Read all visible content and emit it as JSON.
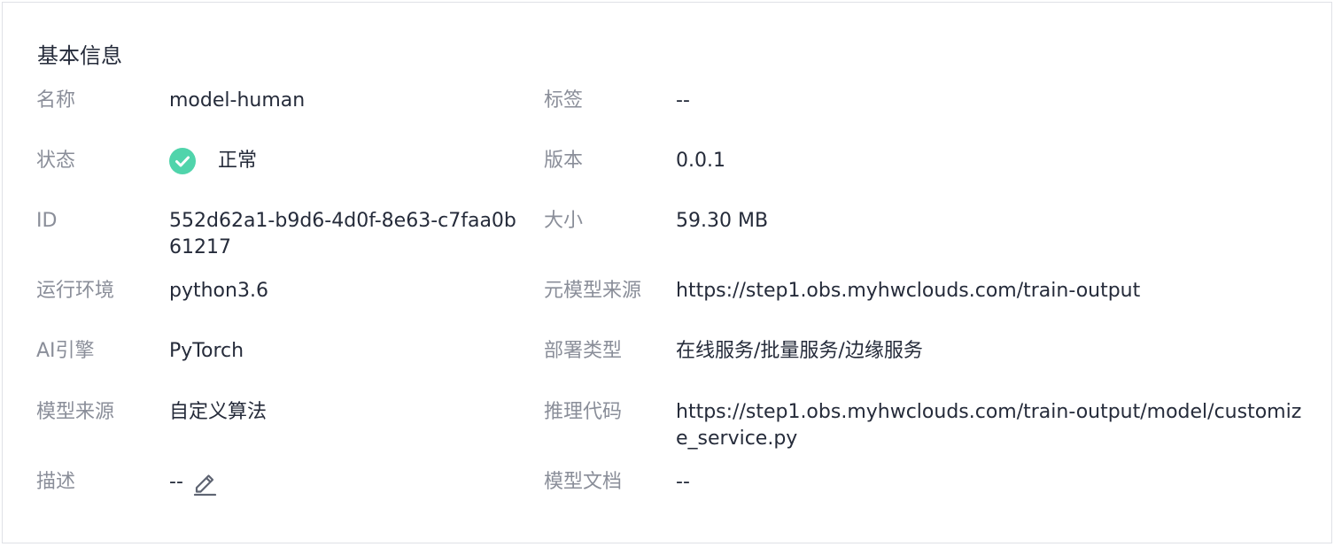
{
  "section": {
    "title": "基本信息"
  },
  "fields": {
    "name": {
      "label": "名称",
      "value": "model-human"
    },
    "tags": {
      "label": "标签",
      "value": "--"
    },
    "status": {
      "label": "状态",
      "value": "正常",
      "icon": "check-circle-icon",
      "color": "#50d4ab"
    },
    "version": {
      "label": "版本",
      "value": "0.0.1"
    },
    "id": {
      "label": "ID",
      "value": "552d62a1-b9d6-4d0f-8e63-c7faa0b61217"
    },
    "size": {
      "label": "大小",
      "value": "59.30 MB"
    },
    "runtime": {
      "label": "运行环境",
      "value": "python3.6"
    },
    "meta_source": {
      "label": "元模型来源",
      "value": "https://step1.obs.myhwclouds.com/train-output"
    },
    "ai_engine": {
      "label": "AI引擎",
      "value": "PyTorch"
    },
    "deploy_type": {
      "label": "部署类型",
      "value": "在线服务/批量服务/边缘服务"
    },
    "model_source": {
      "label": "模型来源",
      "value": "自定义算法"
    },
    "inference_code": {
      "label": "推理代码",
      "value": "https://step1.obs.myhwclouds.com/train-output/model/customize_service.py"
    },
    "description": {
      "label": "描述",
      "value": "--",
      "icon": "edit-icon"
    },
    "model_doc": {
      "label": "模型文档",
      "value": "--"
    }
  },
  "colors": {
    "label": "#8a8e99",
    "value": "#252b3a",
    "border": "#dfe1e6",
    "status_ok": "#50d4ab"
  }
}
